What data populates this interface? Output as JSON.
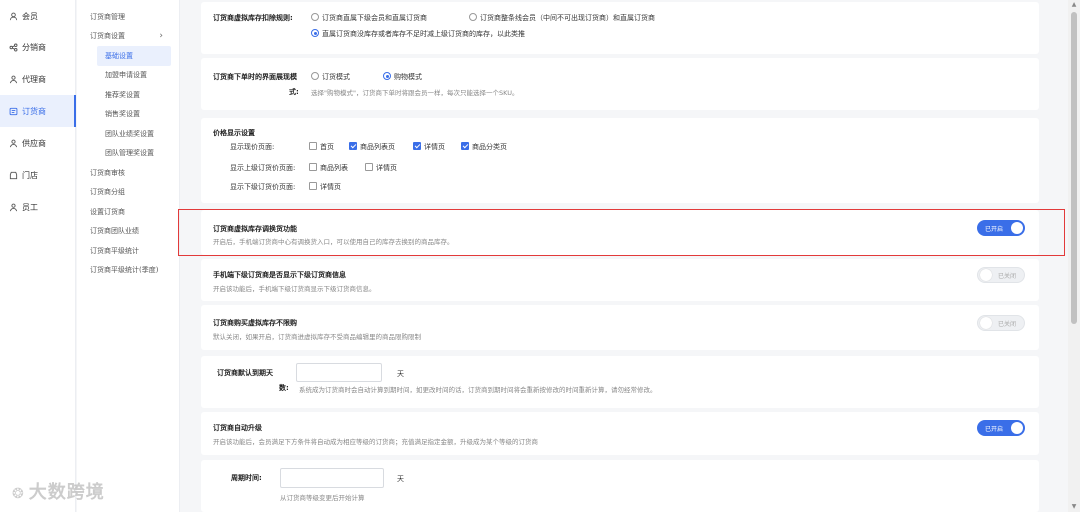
{
  "nav_primary": [
    {
      "label": "会员",
      "icon": "user-icon"
    },
    {
      "label": "分销商",
      "icon": "share-icon"
    },
    {
      "label": "代理商",
      "icon": "agent-icon"
    },
    {
      "label": "订货商",
      "icon": "cart-icon",
      "active": true
    },
    {
      "label": "供应商",
      "icon": "supplier-icon"
    },
    {
      "label": "门店",
      "icon": "store-icon"
    },
    {
      "label": "员工",
      "icon": "staff-icon"
    }
  ],
  "nav_secondary": [
    {
      "label": "订货商管理"
    },
    {
      "label": "订货商设置",
      "chevron": "›"
    },
    {
      "label": "基础设置",
      "sub": true,
      "selected": true
    },
    {
      "label": "加盟申请设置",
      "sub": true
    },
    {
      "label": "推荐奖设置",
      "sub": true
    },
    {
      "label": "销售奖设置",
      "sub": true
    },
    {
      "label": "团队业绩奖设置",
      "sub": true
    },
    {
      "label": "团队管理奖设置",
      "sub": true
    },
    {
      "label": "订货商审核"
    },
    {
      "label": "订货商分组"
    },
    {
      "label": "设置订货商"
    },
    {
      "label": "订货商团队业绩"
    },
    {
      "label": "订货商平级统计"
    },
    {
      "label": "订货商平级统计(季度)"
    }
  ],
  "stock_rule": {
    "label": "订货商虚拟库存扣除规则:",
    "opt1": "订货商直属下级会员和直属订货商",
    "opt2": "订货商整条线会员（中间不可出现订货商）和直属订货商",
    "opt3": "直属订货商没库存或者库存不足时减上级订货商的库存，以此类推"
  },
  "order_ui": {
    "label_a": "订货商下单时的界面展现模",
    "label_b": "式:",
    "opt1": "订货模式",
    "opt2": "购物模式",
    "hint": "选择\"购物模式\"，订货商下单时将跟会员一样，每次只能选择一个SKU。"
  },
  "price_display": {
    "title": "价格显示设置",
    "row1_label": "显示现价页面:",
    "row1_opts": [
      "首页",
      "商品列表页",
      "详情页",
      "商品分类页"
    ],
    "row2_label": "显示上级订货价页面:",
    "row2_opts": [
      "商品列表",
      "详情页"
    ],
    "row3_label": "显示下级订货价页面:",
    "row3_opts": [
      "详情页"
    ]
  },
  "swap_feature": {
    "title": "订货商虚拟库存调换货功能",
    "desc": "开启后，手机端订货商中心有调换货入口，可以使用自己的库存去换别的商品库存。",
    "toggle": "已开启"
  },
  "mobile_lower": {
    "title": "手机端下级订货商是否显示下级订货商信息",
    "desc": "开启该功能后，手机端下级订货商显示下级订货商信息。",
    "toggle": "已关闭"
  },
  "no_limit": {
    "title": "订货商购买虚拟库存不限购",
    "desc": "默认关闭，如果开启，订货商进虚拟库存不受商品编辑里的商品限购限制",
    "toggle": "已关闭"
  },
  "default_expire": {
    "label_a": "订货商默认到期天",
    "label_b": "数:",
    "unit": "天",
    "hint": "系统成为订货商时会自动计算到期时间，如更改时间的话，订货商到期时间将会重新按修改的时间重新计算，请勿经常修改。",
    "value": ""
  },
  "auto_upgrade": {
    "title": "订货商自动升级",
    "desc": "开启该功能后，会员满足下方条件将自动成为相应等级的订货商；充值满足指定金额，升级成为某个等级的订货商",
    "toggle": "已开启"
  },
  "cycle": {
    "label": "周期时间:",
    "unit": "天",
    "hint": "从订货商等级变更后开始计算",
    "value": ""
  },
  "watermark": "大数跨境"
}
